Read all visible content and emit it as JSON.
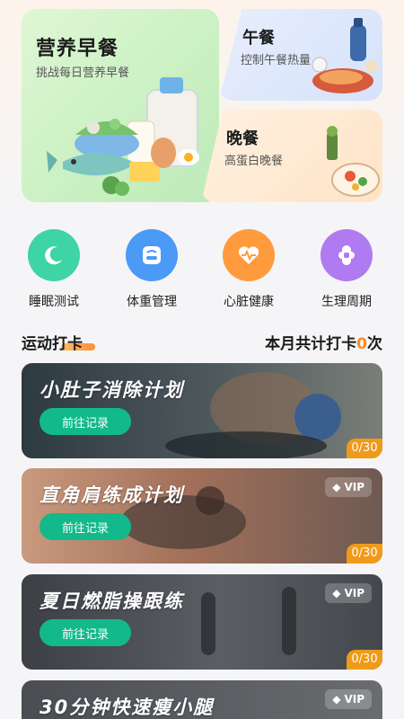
{
  "meals": {
    "breakfast": {
      "title": "营养早餐",
      "subtitle": "挑战每日营养早餐"
    },
    "lunch": {
      "title": "午餐",
      "subtitle": "控制午餐热量"
    },
    "dinner": {
      "title": "晚餐",
      "subtitle": "高蛋白晚餐"
    }
  },
  "tools": [
    {
      "label": "睡眠测试",
      "icon": "moon-icon",
      "color": "#3fd4a4"
    },
    {
      "label": "体重管理",
      "icon": "scale-icon",
      "color": "#4b9af5"
    },
    {
      "label": "心脏健康",
      "icon": "heart-icon",
      "color": "#ff9b3d"
    },
    {
      "label": "生理周期",
      "icon": "cycle-icon",
      "color": "#b07bf0"
    }
  ],
  "section": {
    "title": "运动打卡",
    "count_prefix": "本月共计打卡",
    "count_value": "0",
    "count_suffix": "次"
  },
  "plans": [
    {
      "title": "小肚子消除计划",
      "button": "前往记录",
      "progress": "0/30",
      "vip": ""
    },
    {
      "title": "直角肩练成计划",
      "button": "前往记录",
      "progress": "0/30",
      "vip": "VIP"
    },
    {
      "title": "夏日燃脂操跟练",
      "button": "前往记录",
      "progress": "0/30",
      "vip": "VIP"
    },
    {
      "title": "30分钟快速瘦小腿",
      "button": "",
      "progress": "",
      "vip": "VIP"
    }
  ]
}
